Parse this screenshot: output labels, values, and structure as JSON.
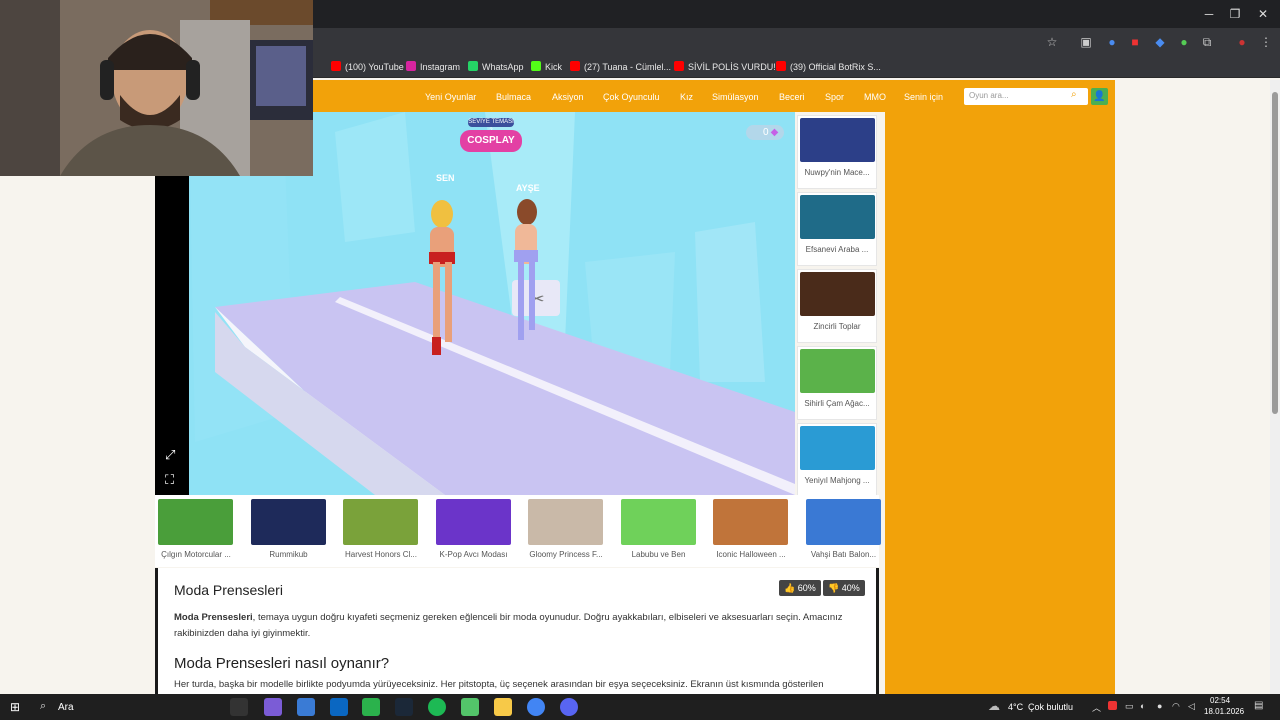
{
  "window": {
    "minimize": "─",
    "restore": "❐",
    "close": "✕"
  },
  "bookmarks": [
    {
      "label": "(100) YouTube",
      "color": "#ff0000"
    },
    {
      "label": "Instagram",
      "color": "#d6249f"
    },
    {
      "label": "WhatsApp",
      "color": "#25d366"
    },
    {
      "label": "Kick",
      "color": "#53fc18"
    },
    {
      "label": "(27) Tuana - Cümlel...",
      "color": "#ff0000"
    },
    {
      "label": "SİVİL POLİS VURDU!...",
      "color": "#ff0000"
    },
    {
      "label": "(39) Official BotRix S...",
      "color": "#ff0000"
    }
  ],
  "nav": {
    "items": [
      "Yeni Oyunlar",
      "Bulmaca",
      "Aksiyon",
      "Çok Oyunculu",
      "Kız",
      "Simülasyon",
      "Beceri",
      "Spor",
      "MMO",
      "Senin için"
    ],
    "search_placeholder": "Oyun ara..."
  },
  "game": {
    "round_label": "SEVİYE TEMASI 2",
    "theme_label": "COSPLAY",
    "player_you": "SEN",
    "player_opponent": "AYŞE",
    "gems": "0"
  },
  "sidebar_games": [
    {
      "label": "Nuwpy'nin Mace...",
      "color": "#2c3f88"
    },
    {
      "label": "Efsanevi Araba ...",
      "color": "#1f6b88"
    },
    {
      "label": "Zincirli Toplar",
      "color": "#4a2b1a"
    },
    {
      "label": "Sihirli Çam Ağac...",
      "color": "#5bb24a"
    },
    {
      "label": "Yeniyıl Mahjong ...",
      "color": "#2a9bd4"
    }
  ],
  "bottom_games": [
    {
      "label": "Çılgın Motorcular ...",
      "color": "#4a9e3a"
    },
    {
      "label": "Rummikub",
      "color": "#1e2a5a"
    },
    {
      "label": "Harvest Honors Cl...",
      "color": "#7aa23a"
    },
    {
      "label": "K-Pop Avcı Modası",
      "color": "#6b34c9"
    },
    {
      "label": "Gloomy Princess F...",
      "color": "#c9b9a8"
    },
    {
      "label": "Labubu ve Ben",
      "color": "#6fd15a"
    },
    {
      "label": "Iconic Halloween ...",
      "color": "#c0743a"
    },
    {
      "label": "Vahşi Batı Balon...",
      "color": "#3a79d4"
    }
  ],
  "article": {
    "title": "Moda Prensesleri",
    "like": "60%",
    "dislike": "40%",
    "desc_bold": "Moda Prensesleri",
    "desc_rest": ", temaya uygun doğru kıyafeti seçmeniz gereken eğlenceli bir moda oyunudur. Doğru ayakkabıları, elbiseleri ve aksesuarları seçin. Amacınız rakibinizden daha iyi giyinmektir.",
    "howto_title": "Moda Prensesleri nasıl oynanır?",
    "howto_text": "Her turda, başka bir modelle birlikte podyumda yürüyeceksiniz. Her pitstopta, üç seçenek arasından bir eşya seçeceksiniz. Ekranın üst kısmında gösterilen"
  },
  "taskbar": {
    "search": "Ara",
    "weather_temp": "4°C",
    "weather_desc": "Çok bulutlu",
    "time": "02:54",
    "date": "18.01.2026"
  }
}
